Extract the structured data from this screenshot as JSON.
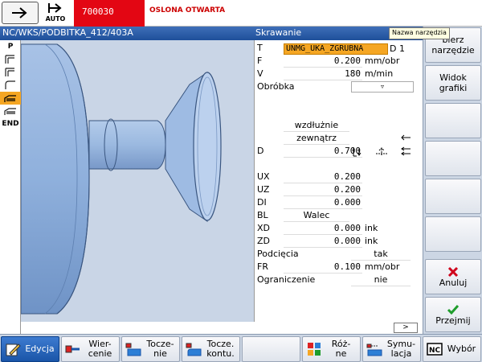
{
  "status": {
    "mode": "AUTO",
    "alarm_number": "700030",
    "alarm_text": "OSLONA OTWARTA"
  },
  "titlebar": {
    "program_path": "NC/WKS/PODBITKA_412/403A",
    "dialog_title": "Skrawanie"
  },
  "tooltip": "Nazwa narzędzia",
  "cycle_strip": {
    "items": [
      {
        "label": "P"
      },
      {
        "label": ""
      },
      {
        "label": ""
      },
      {
        "label": ""
      },
      {
        "label": ""
      },
      {
        "label": ""
      },
      {
        "label": "END"
      }
    ],
    "active_index": 4
  },
  "params": {
    "tool": {
      "label": "T",
      "value": "UNMG_UKA_ZGRUBNA",
      "d_number": "D 1"
    },
    "feed": {
      "label": "F",
      "value": "0.200",
      "unit": "mm/obr"
    },
    "speed": {
      "label": "V",
      "value": "180",
      "unit": "m/min"
    },
    "machining": {
      "label": "Obróbka",
      "value": "▿"
    },
    "direction": "wzdłużnie",
    "position": "zewnątrz",
    "depth": {
      "label": "D",
      "value": "0.700"
    },
    "ux": {
      "label": "UX",
      "value": "0.200"
    },
    "uz": {
      "label": "UZ",
      "value": "0.200"
    },
    "di": {
      "label": "DI",
      "value": "0.000"
    },
    "bl": {
      "label": "BL",
      "value": "Walec"
    },
    "xd": {
      "label": "XD",
      "value": "0.000",
      "unit": "ink"
    },
    "zd": {
      "label": "ZD",
      "value": "0.000",
      "unit": "ink"
    },
    "undercuts": {
      "label": "Podcięcia",
      "value": "tak"
    },
    "fr": {
      "label": "FR",
      "value": "0.100",
      "unit": "mm/obr"
    },
    "limit": {
      "label": "Ograniczenie",
      "value": "nie"
    },
    "scroll_label": ">"
  },
  "vertical_softkeys": [
    {
      "id": "select-tool",
      "line1": "bierz",
      "line2": "narzędzie"
    },
    {
      "id": "graphic-view",
      "line1": "Widok",
      "line2": "grafiki"
    },
    {
      "id": "empty-3",
      "line1": "",
      "line2": ""
    },
    {
      "id": "empty-4",
      "line1": "",
      "line2": ""
    },
    {
      "id": "empty-5",
      "line1": "",
      "line2": ""
    },
    {
      "id": "empty-6",
      "line1": "",
      "line2": ""
    },
    {
      "id": "cancel",
      "line1": "Anuluj",
      "icon": "cancel-x-icon"
    },
    {
      "id": "accept",
      "line1": "Przejmij",
      "icon": "check-icon"
    }
  ],
  "horizontal_softkeys": [
    {
      "id": "edit",
      "line1": "Edycja",
      "line2": "",
      "icon": "edit-pencil-icon",
      "active": true
    },
    {
      "id": "drilling",
      "line1": "Wier-",
      "line2": "cenie",
      "icon": "drill-icon"
    },
    {
      "id": "turning",
      "line1": "Tocze-",
      "line2": "nie",
      "icon": "turning-icon"
    },
    {
      "id": "contour-turning",
      "line1": "Tocze.",
      "line2": "kontu.",
      "icon": "contour-turning-icon"
    },
    {
      "id": "empty",
      "line1": "",
      "line2": ""
    },
    {
      "id": "misc",
      "line1": "Róż-",
      "line2": "ne",
      "icon": "misc-grid-icon"
    },
    {
      "id": "simulation",
      "line1": "Symu-",
      "line2": "lacja",
      "icon": "simulation-icon"
    },
    {
      "id": "select",
      "line1": "Wybór",
      "line2": "",
      "icon": "nc-select-icon"
    }
  ],
  "colors": {
    "alarm_bg": "#e30613",
    "title_bg": "#1e4f9a",
    "highlight": "#f5a623",
    "workpiece": "#8fb0dc",
    "cancel_red": "#d0021b",
    "accept_green": "#1f9d2c"
  }
}
